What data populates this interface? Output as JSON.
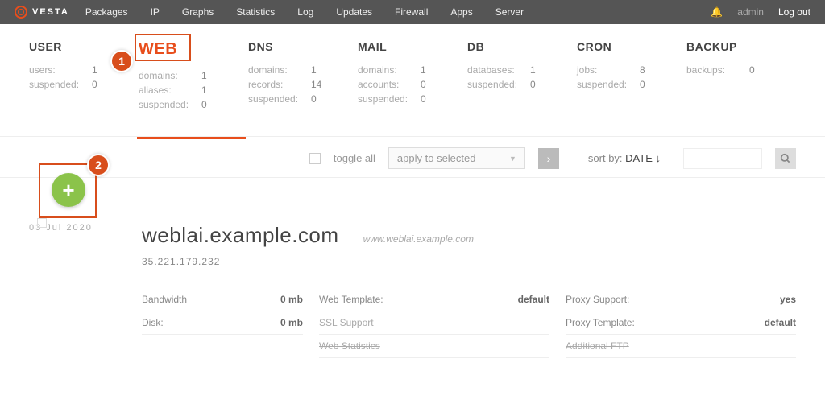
{
  "brand": "VESTA",
  "nav": [
    "Packages",
    "IP",
    "Graphs",
    "Statistics",
    "Log",
    "Updates",
    "Firewall",
    "Apps",
    "Server"
  ],
  "user": "admin",
  "logout": "Log out",
  "stats": [
    {
      "title": "USER",
      "rows": [
        {
          "k": "users:",
          "v": "1"
        },
        {
          "k": "suspended:",
          "v": "0"
        }
      ],
      "active": false
    },
    {
      "title": "WEB",
      "rows": [
        {
          "k": "domains:",
          "v": "1"
        },
        {
          "k": "aliases:",
          "v": "1"
        },
        {
          "k": "suspended:",
          "v": "0"
        }
      ],
      "active": true
    },
    {
      "title": "DNS",
      "rows": [
        {
          "k": "domains:",
          "v": "1"
        },
        {
          "k": "records:",
          "v": "14"
        },
        {
          "k": "suspended:",
          "v": "0"
        }
      ],
      "active": false
    },
    {
      "title": "MAIL",
      "rows": [
        {
          "k": "domains:",
          "v": "1"
        },
        {
          "k": "accounts:",
          "v": "0"
        },
        {
          "k": "suspended:",
          "v": "0"
        }
      ],
      "active": false
    },
    {
      "title": "DB",
      "rows": [
        {
          "k": "databases:",
          "v": "1"
        },
        {
          "k": "suspended:",
          "v": "0"
        }
      ],
      "active": false
    },
    {
      "title": "CRON",
      "rows": [
        {
          "k": "jobs:",
          "v": "8"
        },
        {
          "k": "suspended:",
          "v": "0"
        }
      ],
      "active": false
    },
    {
      "title": "BACKUP",
      "rows": [
        {
          "k": "backups:",
          "v": "0"
        }
      ],
      "active": false
    }
  ],
  "toolbar": {
    "toggle": "toggle all",
    "select": "apply to selected",
    "sort_label": "sort by:",
    "sort_value": "DATE ↓"
  },
  "entry": {
    "date": "03 Jul 2020",
    "domain": "weblai.example.com",
    "alias": "www.weblai.example.com",
    "ip": "35.221.179.232",
    "col1": [
      {
        "k": "Bandwidth",
        "v": "0 mb"
      },
      {
        "k": "Disk:",
        "v": "0 mb"
      }
    ],
    "col2": [
      {
        "k": "Web Template:",
        "v": "default",
        "strike": false
      },
      {
        "k": "SSL Support",
        "v": "",
        "strike": true
      },
      {
        "k": "Web Statistics",
        "v": "",
        "strike": true
      }
    ],
    "col3": [
      {
        "k": "Proxy Support:",
        "v": "yes",
        "strike": false
      },
      {
        "k": "Proxy Template:",
        "v": "default",
        "strike": false
      },
      {
        "k": "Additional FTP",
        "v": "",
        "strike": true
      }
    ]
  },
  "markers": {
    "one": "1",
    "two": "2"
  }
}
